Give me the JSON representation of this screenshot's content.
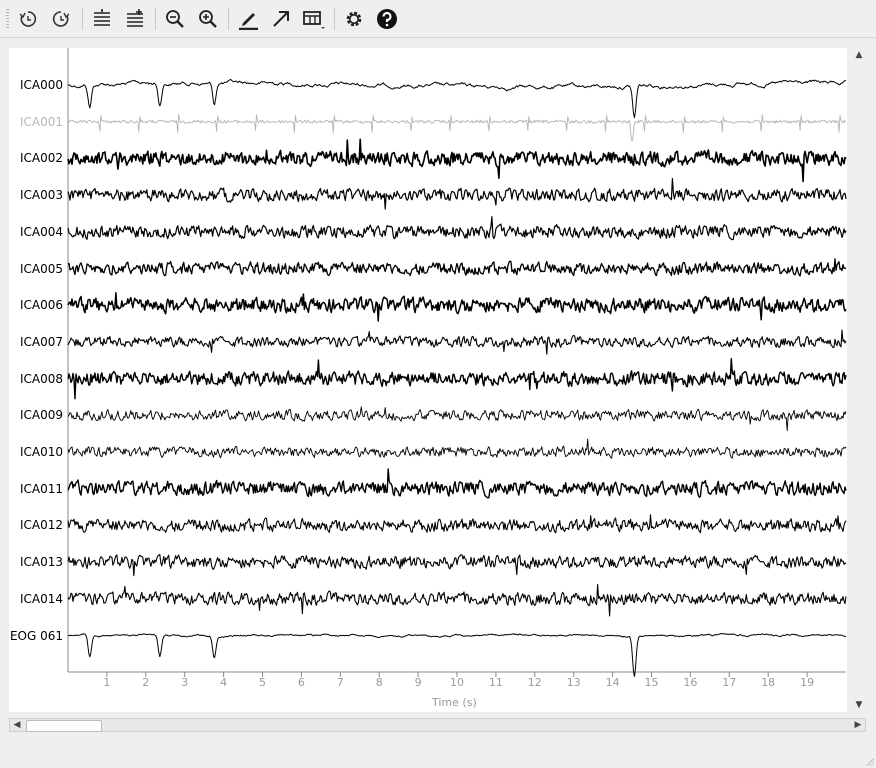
{
  "toolbar": {
    "buttons": [
      {
        "name": "undo-history-icon",
        "tooltip": ""
      },
      {
        "name": "redo-history-icon",
        "tooltip": ""
      },
      {
        "name": "fewer-channels-icon",
        "tooltip": ""
      },
      {
        "name": "more-channels-icon",
        "tooltip": ""
      },
      {
        "name": "zoom-out-icon",
        "tooltip": ""
      },
      {
        "name": "zoom-in-icon",
        "tooltip": ""
      },
      {
        "name": "annotation-pen-icon",
        "tooltip": ""
      },
      {
        "name": "arrow-icon",
        "tooltip": ""
      },
      {
        "name": "projection-table-icon",
        "tooltip": ""
      },
      {
        "name": "settings-gear-icon",
        "tooltip": ""
      },
      {
        "name": "help-icon",
        "tooltip": ""
      }
    ]
  },
  "plot": {
    "channels": [
      {
        "label": "ICA000",
        "dim": false,
        "amp": 3,
        "weight": 1.0
      },
      {
        "label": "ICA001",
        "dim": true,
        "amp": 3,
        "weight": 0.9
      },
      {
        "label": "ICA002",
        "dim": false,
        "amp": 7,
        "weight": 1.6
      },
      {
        "label": "ICA003",
        "dim": false,
        "amp": 6,
        "weight": 1.2
      },
      {
        "label": "ICA004",
        "dim": false,
        "amp": 6,
        "weight": 1.2
      },
      {
        "label": "ICA005",
        "dim": false,
        "amp": 6,
        "weight": 1.3
      },
      {
        "label": "ICA006",
        "dim": false,
        "amp": 7,
        "weight": 1.5
      },
      {
        "label": "ICA007",
        "dim": false,
        "amp": 5,
        "weight": 1.1
      },
      {
        "label": "ICA008",
        "dim": false,
        "amp": 7,
        "weight": 1.4
      },
      {
        "label": "ICA009",
        "dim": false,
        "amp": 5,
        "weight": 0.9
      },
      {
        "label": "ICA010",
        "dim": false,
        "amp": 5,
        "weight": 0.9
      },
      {
        "label": "ICA011",
        "dim": false,
        "amp": 7,
        "weight": 1.4
      },
      {
        "label": "ICA012",
        "dim": false,
        "amp": 6,
        "weight": 1.1
      },
      {
        "label": "ICA013",
        "dim": false,
        "amp": 6,
        "weight": 1.1
      },
      {
        "label": "ICA014",
        "dim": false,
        "amp": 6,
        "weight": 1.1
      },
      {
        "label": "EOG 061",
        "dim": false,
        "amp": 1.5,
        "weight": 1.0
      }
    ],
    "xticks": [
      "1",
      "2",
      "3",
      "4",
      "5",
      "6",
      "7",
      "8",
      "9",
      "10",
      "11",
      "12",
      "13",
      "14",
      "15",
      "16",
      "17",
      "18",
      "19"
    ],
    "xrange": [
      0,
      20
    ],
    "xlabel": "Time (s)",
    "blink_times": [
      0.5,
      2.3,
      3.7,
      14.5
    ],
    "heartbeat_start": 0.8,
    "heartbeat_interval": 1.0
  }
}
